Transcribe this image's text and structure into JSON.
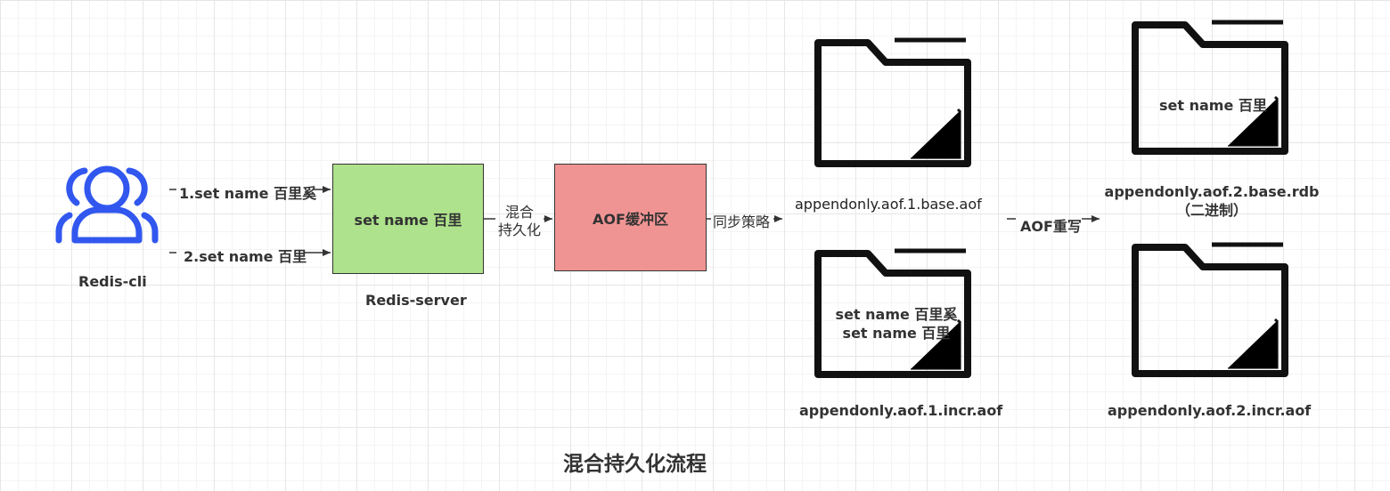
{
  "client": {
    "label": "Redis-cli"
  },
  "commands": {
    "cmd1": "1.set name 百里奚",
    "cmd2": "2.set name 百里"
  },
  "server": {
    "box_text": "set name 百里",
    "label": "Redis-server"
  },
  "mixed_persist": {
    "line1": "混合",
    "line2": "持久化"
  },
  "buffer": {
    "label": "AOF缓冲区"
  },
  "sync_strategy": {
    "label": "同步策略"
  },
  "files": {
    "base_aof": {
      "label": "appendonly.aof.1.base.aof"
    },
    "incr_aof": {
      "label": "appendonly.aof.1.incr.aof",
      "content_line1": "set name 百里奚",
      "content_line2": "set name 百里"
    },
    "base_rdb": {
      "label_line1": "appendonly.aof.2.base.rdb",
      "label_line2": "（二进制）",
      "content": "set name 百里"
    },
    "incr_aof2": {
      "label": "appendonly.aof.2.incr.aof"
    }
  },
  "rewrite": {
    "label": "AOF重写"
  },
  "title": "混合持久化流程",
  "colors": {
    "user_icon": "#3157ef",
    "server_box": "#aee28c",
    "buffer_box": "#f09493",
    "stroke": "#333333"
  }
}
